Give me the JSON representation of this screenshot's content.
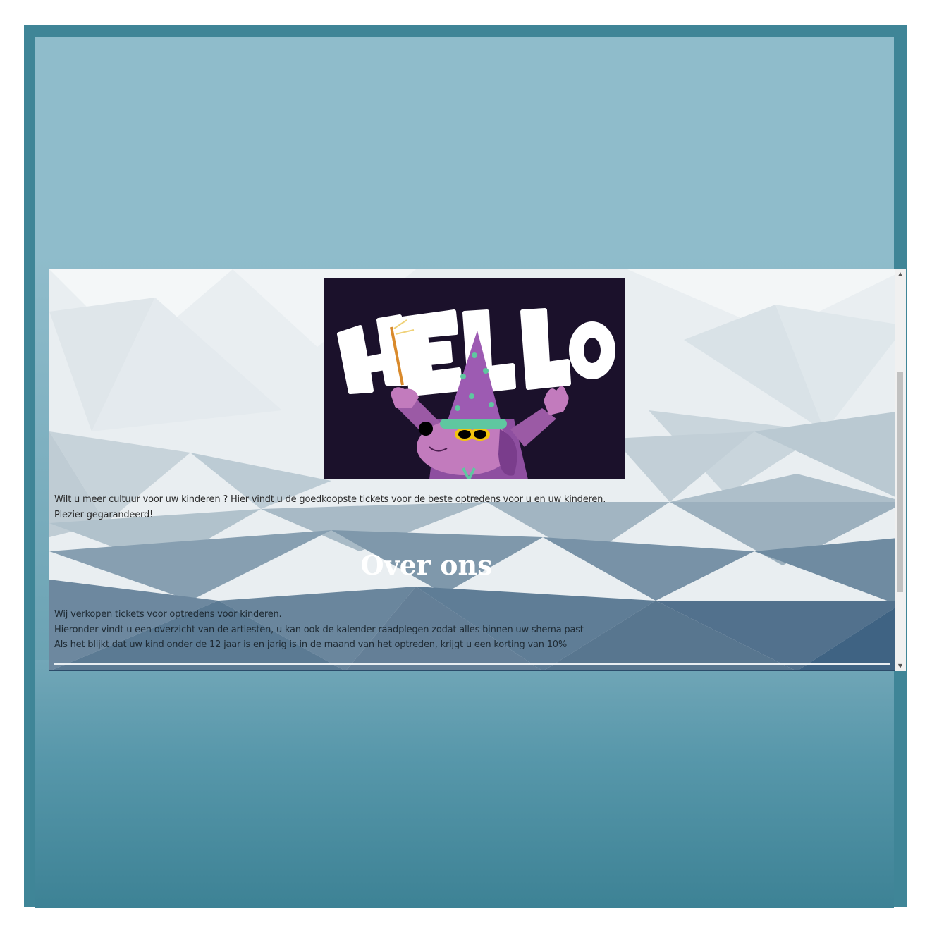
{
  "hero": {
    "image_alt": "HELLO wizard dog illustration",
    "image_text": "HELLO"
  },
  "intro": {
    "line1": "Wilt u meer cultuur voor uw kinderen ? Hier vindt u de goedkoopste tickets voor de beste optredens voor u en uw kinderen.",
    "line2": "Plezier gegarandeerd!"
  },
  "about": {
    "title": "Over ons",
    "line1": "Wij verkopen tickets voor optredens voor kinderen.",
    "line2": "Hieronder vindt u een overzicht van de artiesten, u kan ook de kalender raadplegen zodat alles binnen uw shema past",
    "line3": "Als het blijkt dat uw kind onder de 12 jaar is en jarig is in de maand van het optreden, krijgt u een korting van 10%"
  },
  "scrollbar": {
    "up_arrow": "▲",
    "down_arrow": "▼"
  },
  "colors": {
    "frame": "#3f8597",
    "top_band": "#8fbccb",
    "hero_bg": "#1b112b",
    "wizard_purple": "#9b5aa5",
    "hat_purple": "#8e4fa0",
    "star_green": "#5fc7a0"
  }
}
